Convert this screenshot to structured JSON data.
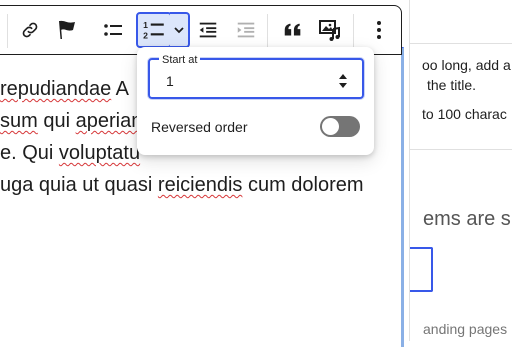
{
  "editor": {
    "lines": [
      [
        "",
        "repudiandae",
        " A"
      ],
      [
        "",
        "sum",
        " qui ",
        "aperiam"
      ],
      [
        "e. Qui ",
        "voluptatu"
      ],
      [
        "uga quia ut quasi ",
        "reiciendis",
        " cum dolorem"
      ]
    ]
  },
  "toolbar": {
    "buttons": [
      "link-icon",
      "flag-icon",
      "unordered-list-icon",
      "ordered-list-icon",
      "chevron-down-icon",
      "outdent-icon",
      "indent-icon",
      "quote-icon",
      "image-music-icon",
      "more-options-icon"
    ]
  },
  "popover": {
    "start_label": "Start at",
    "start_value": "1",
    "reversed_label": "Reversed order",
    "reversed_on": false
  },
  "sidebar": {
    "line1": "oo long, add a",
    "line2": "the title.",
    "line3": "to 100 charac",
    "heading": "ems are s",
    "footer": "anding pages"
  },
  "colors": {
    "accent": "#3858e9",
    "active_bg": "#dce6fb",
    "spell": "#d63638",
    "toggle_off": "#757575"
  }
}
